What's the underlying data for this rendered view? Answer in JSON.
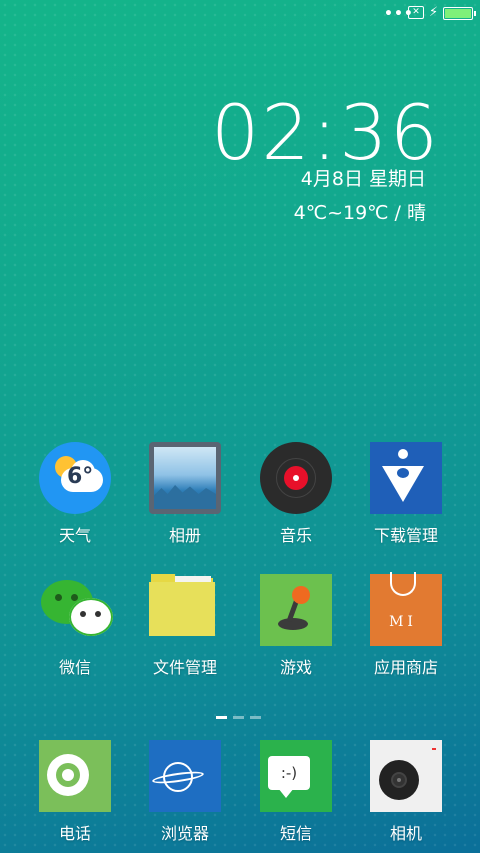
{
  "status_bar": {
    "more_icon": "more-dots-icon",
    "sim_icon": "no-sim-icon",
    "charging_icon": "charging-bolt-icon",
    "battery_icon": "battery-icon"
  },
  "clock": {
    "time": "02:36",
    "date": "4月8日 星期日",
    "weather": "4℃~19℃ / 晴"
  },
  "apps": [
    {
      "label": "天气",
      "icon": "weather-icon",
      "temp": "6°"
    },
    {
      "label": "相册",
      "icon": "gallery-icon"
    },
    {
      "label": "音乐",
      "icon": "music-icon"
    },
    {
      "label": "下载管理",
      "icon": "download-manager-icon"
    },
    {
      "label": "微信",
      "icon": "wechat-icon"
    },
    {
      "label": "文件管理",
      "icon": "file-manager-icon"
    },
    {
      "label": "游戏",
      "icon": "game-icon"
    },
    {
      "label": "应用商店",
      "icon": "app-store-icon",
      "badge": "MI"
    }
  ],
  "page_indicator": {
    "pages": 3,
    "current": 1
  },
  "dock": [
    {
      "label": "电话",
      "icon": "phone-icon"
    },
    {
      "label": "浏览器",
      "icon": "browser-icon"
    },
    {
      "label": "短信",
      "icon": "sms-icon",
      "glyph": ":-)"
    },
    {
      "label": "相机",
      "icon": "camera-icon"
    }
  ]
}
